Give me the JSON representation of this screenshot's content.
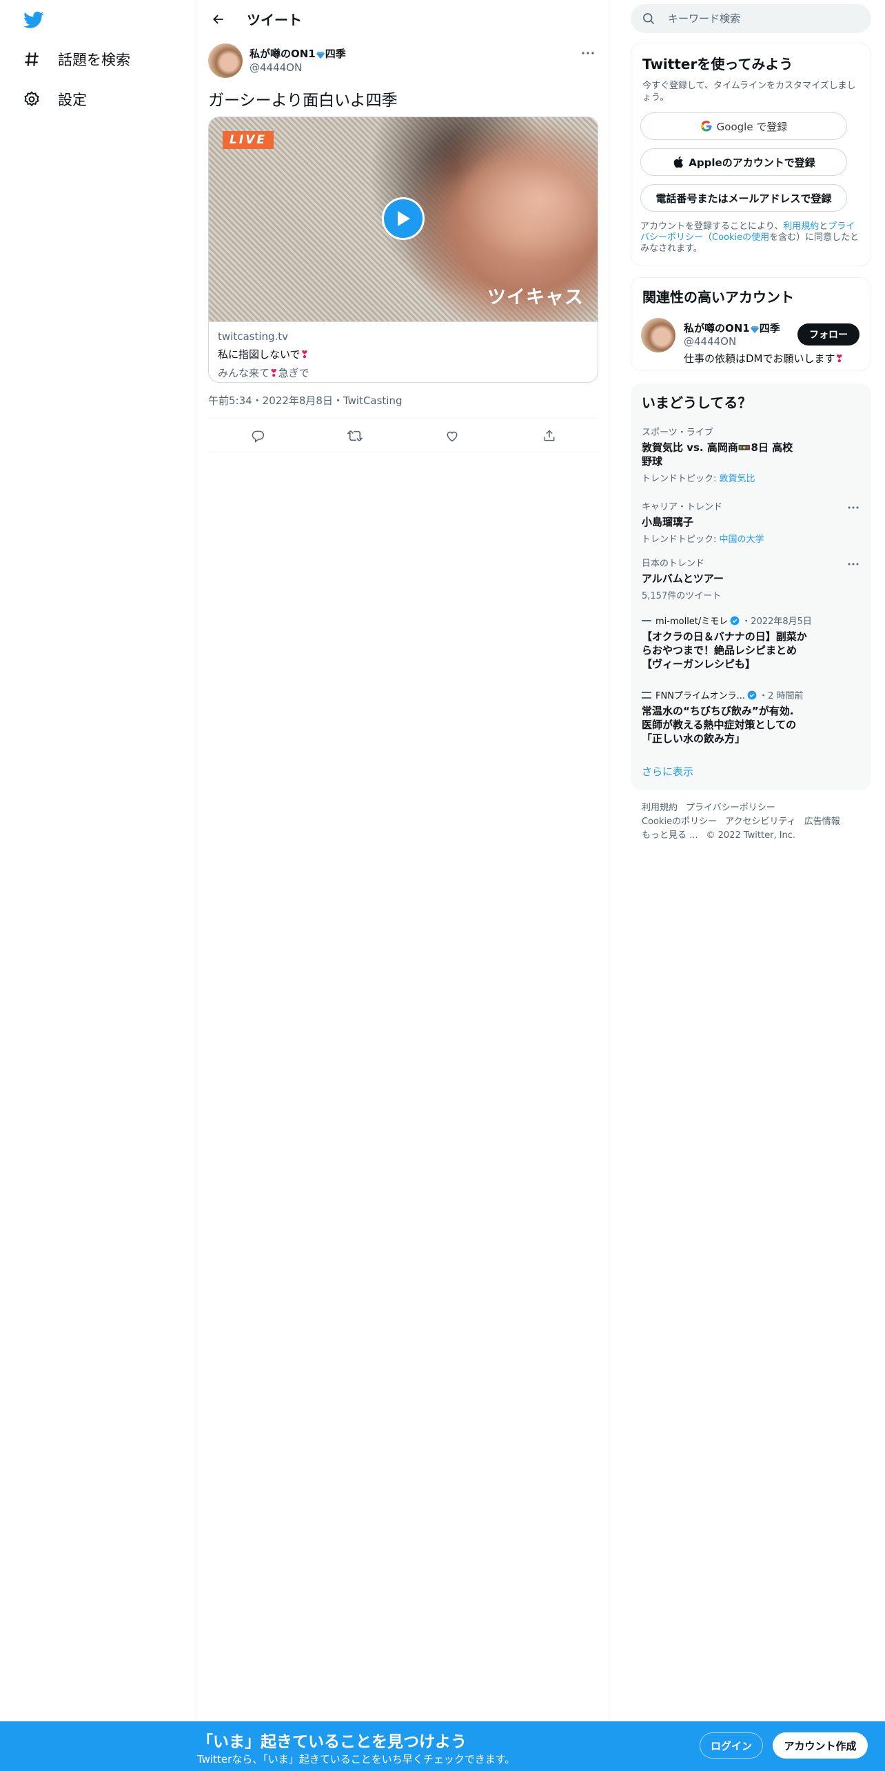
{
  "colors": {
    "accent": "#1d9bf0",
    "text": "#0f1419",
    "muted": "#536471",
    "live": "#f06a35",
    "heart": "#e0245e"
  },
  "sidebar": {
    "logo_icon": "twitter-bird-icon",
    "items": [
      {
        "label": "話題を検索",
        "icon": "hashtag-icon"
      },
      {
        "label": "設定",
        "icon": "gear-icon"
      }
    ]
  },
  "header": {
    "title": "ツイート"
  },
  "tweet": {
    "author": {
      "name_before": "私が噂のON1",
      "name_after": "四季",
      "handle": "@4444ON"
    },
    "text": "ガーシーより面白いよ四季",
    "card": {
      "live_badge": "LIVE",
      "brand": "ツイキャス",
      "domain": "twitcasting.tv",
      "title": "私に指図しないで",
      "desc_before": "みんな来て",
      "desc_after": "急ぎで"
    },
    "meta": "午前5:34・2022年8月8日・TwitCasting"
  },
  "search": {
    "placeholder": "キーワード検索"
  },
  "signup": {
    "title": "Twitterを使ってみよう",
    "subtitle": "今すぐ登録して、タイムラインをカスタマイズしましょう。",
    "google_label": "Google で登録",
    "apple_label": "Appleのアカウントで登録",
    "phone_label": "電話番号またはメールアドレスで登録",
    "legal_1": "アカウントを登録することにより、",
    "legal_terms": "利用規約",
    "legal_2": "と",
    "legal_privacy": "プライバシーポリシー",
    "legal_3": "（",
    "legal_cookie": "Cookieの使用",
    "legal_4": "を含む）に同意したとみなされます。"
  },
  "relevant": {
    "title": "関連性の高いアカウント",
    "name_before": "私が噂のON1",
    "name_after": "四季",
    "handle": "@4444ON",
    "bio": "仕事の依頼はDMでお願いします",
    "follow_label": "フォロー"
  },
  "trends": {
    "title": "いまどうしてる？",
    "items": [
      {
        "context": "スポーツ・ライブ",
        "title": "敦賀気比 vs. 高岡商🚥8日 高校野球",
        "topic_label": "トレンドトピック: ",
        "topic_link": "敦賀気比"
      },
      {
        "context": "キャリア・トレンド",
        "title": "小島瑠璃子",
        "topic_label": "トレンドトピック: ",
        "topic_link": "中国の大学"
      },
      {
        "context": "日本のトレンド",
        "title": "アルバムとツアー",
        "count": "5,157件のツイート"
      }
    ],
    "news": [
      {
        "source": "mi-mollet/ミモレ",
        "time": "・2022年8月5日",
        "title": "【オクラの日＆バナナの日】副菜からおやつまで！絶品レシピまとめ【ヴィーガンレシピも】"
      },
      {
        "source": "FNNプライムオンラ...",
        "time": "・2 時間前",
        "title": "常温水の“ちびちび飲み”が有効. 医師が教える熱中症対策としての「正しい水の飲み方」"
      }
    ],
    "show_more": "さらに表示"
  },
  "footer": {
    "links": [
      "利用規約",
      "プライバシーポリシー",
      "Cookieのポリシー",
      "アクセシビリティ",
      "広告情報",
      "もっと見る ..."
    ],
    "copyright": "© 2022 Twitter, Inc."
  },
  "bottom_bar": {
    "title": "「いま」起きていることを見つけよう",
    "subtitle": "Twitterなら、「いま」起きていることをいち早くチェックできます。",
    "login_label": "ログイン",
    "signup_label": "アカウント作成"
  }
}
